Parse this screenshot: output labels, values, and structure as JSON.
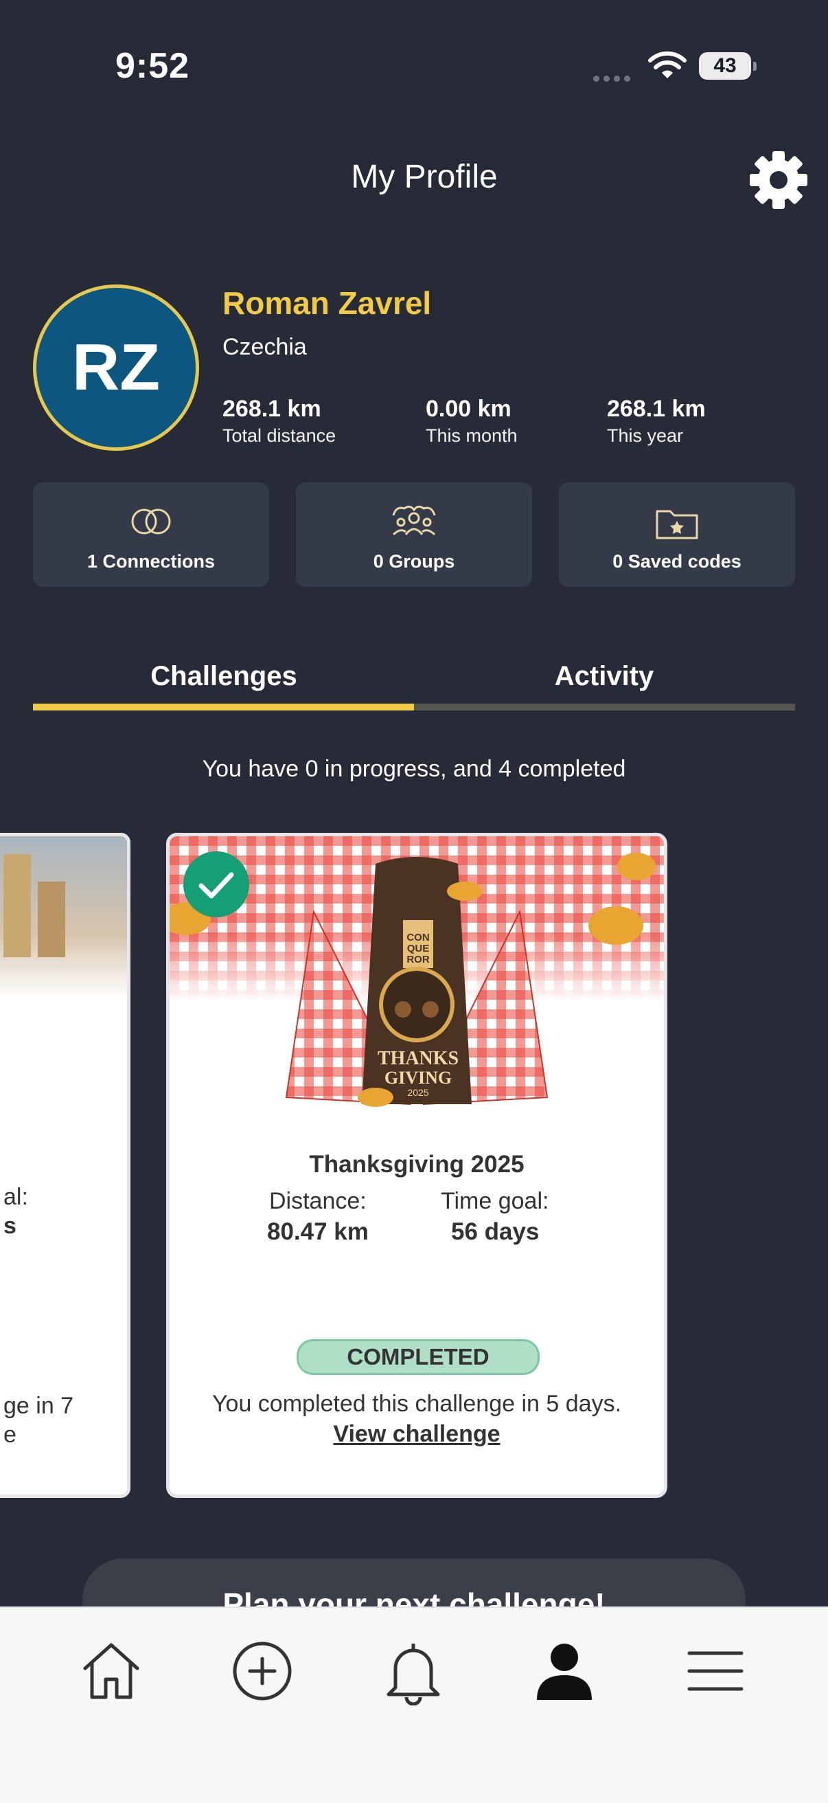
{
  "status_bar": {
    "time": "9:52",
    "battery": "43"
  },
  "header": {
    "title": "My Profile"
  },
  "profile": {
    "initials": "RZ",
    "name": "Roman Zavrel",
    "country": "Czechia",
    "stats": [
      {
        "value": "268.1 km",
        "label": "Total distance"
      },
      {
        "value": "0.00 km",
        "label": "This month"
      },
      {
        "value": "268.1 km",
        "label": "This year"
      }
    ],
    "chips": [
      {
        "label": "1 Connections",
        "icon": "connections-icon"
      },
      {
        "label": "0 Groups",
        "icon": "groups-icon"
      },
      {
        "label": "0 Saved codes",
        "icon": "saved-codes-folder-icon"
      }
    ]
  },
  "tabs": [
    {
      "label": "Challenges"
    },
    {
      "label": "Activity"
    }
  ],
  "summary": "You have 0 in progress, and 4 completed",
  "left_card": {
    "line1": "al:",
    "line2": "s",
    "line3": "ge in 7",
    "line4": "e"
  },
  "card": {
    "title": "Thanksgiving 2025",
    "distance_label": "Distance:",
    "distance_value": "80.47 km",
    "time_label": "Time goal:",
    "time_value": "56 days",
    "status": "COMPLETED",
    "completion_text": "You completed this challenge in 5 days.",
    "link_text": "View challenge",
    "medal_lettering": [
      "CON",
      "QUE",
      "ROR",
      "THANKS",
      "GIVING",
      "2025"
    ]
  },
  "plan_button": "Plan your next challenge!",
  "nav": [
    {
      "icon": "home-icon"
    },
    {
      "icon": "add-circle-icon"
    },
    {
      "icon": "bell-icon"
    },
    {
      "icon": "profile-icon"
    },
    {
      "icon": "menu-icon"
    }
  ],
  "colors": {
    "accent": "#f1cb46",
    "avatar_bg": "#0c5680",
    "success": "#14a074",
    "background": "#262a36"
  }
}
